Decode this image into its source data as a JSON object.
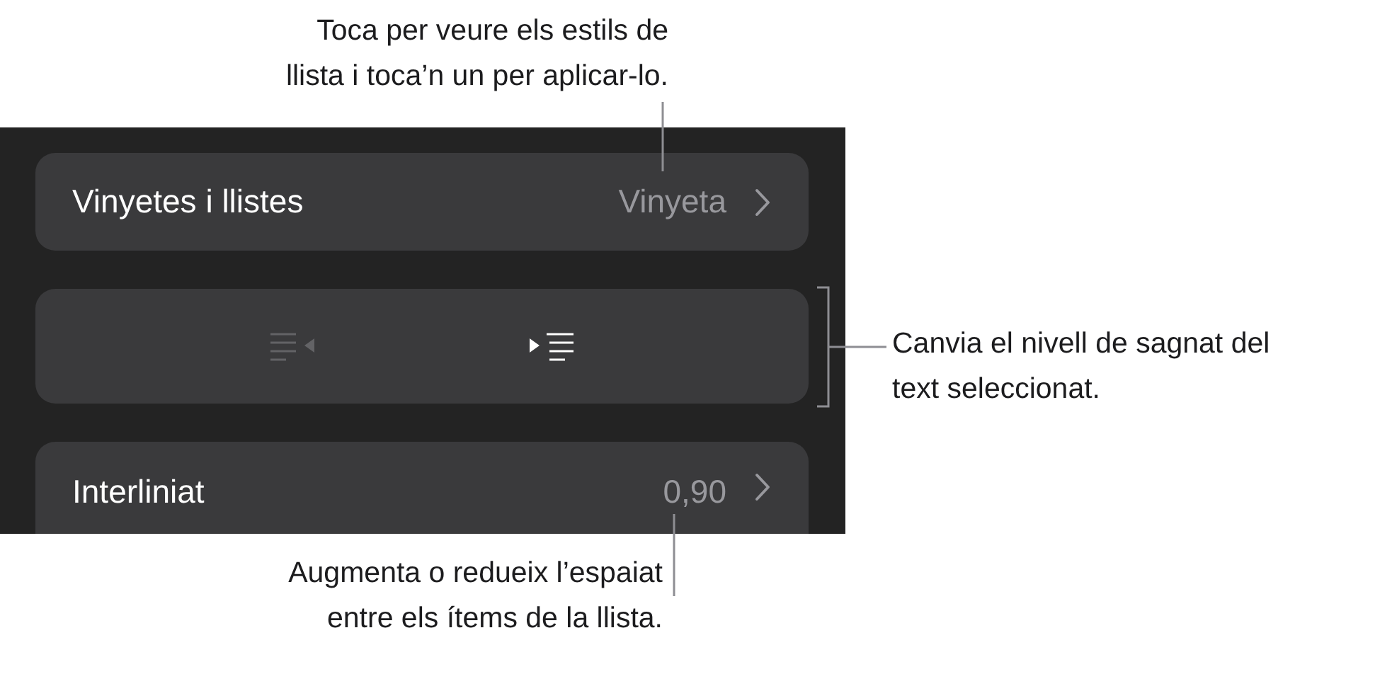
{
  "callouts": [
    {
      "kind": "top",
      "text": "Toca per veure els estils de llista i toca’n un per aplicar-lo."
    },
    {
      "kind": "right",
      "text": "Canvia el nivell de sagnat del text seleccionat."
    },
    {
      "kind": "bottom",
      "text": "Augmenta o redueix l’espaiat entre els ítems de la llista."
    }
  ],
  "rows": [
    {
      "kind": "value",
      "label": "Vinyetes i llistes",
      "value": "Vinyeta"
    },
    {
      "kind": "indent",
      "buttons": [
        {
          "kind": "decrease",
          "disabled": true
        },
        {
          "kind": "increase",
          "disabled": false
        }
      ]
    },
    {
      "kind": "value",
      "label": "Interliniat",
      "value": "0,90"
    }
  ]
}
